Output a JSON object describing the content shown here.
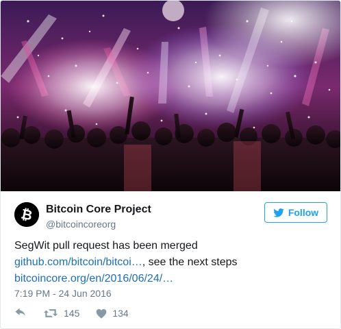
{
  "tweet": {
    "author": {
      "display_name": "Bitcoin Core Project",
      "handle": "@bitcoincoreorg",
      "avatar_icon": "bitcoin-logo-icon"
    },
    "follow_button": {
      "label": "Follow",
      "icon": "twitter-bird-icon",
      "color": "#1da1f2"
    },
    "text_line_1": "SegWit pull request has been merged",
    "link_1": "github.com/bitcoin/bitcoi…",
    "text_after_link_1": ", see the next steps",
    "link_2": "bitcoincore.org/en/2016/06/24/…",
    "timestamp": "7:19 PM - 24 Jun 2016",
    "actions": {
      "reply": {
        "icon": "reply-icon"
      },
      "retweet": {
        "icon": "retweet-icon",
        "count": "145"
      },
      "like": {
        "icon": "heart-icon",
        "count": "134"
      }
    },
    "colors": {
      "link": "#1b6fb8",
      "secondary_text": "#657786"
    }
  },
  "media": {
    "kind": "photo",
    "subject": "concert crowd with stage lights and confetti"
  }
}
